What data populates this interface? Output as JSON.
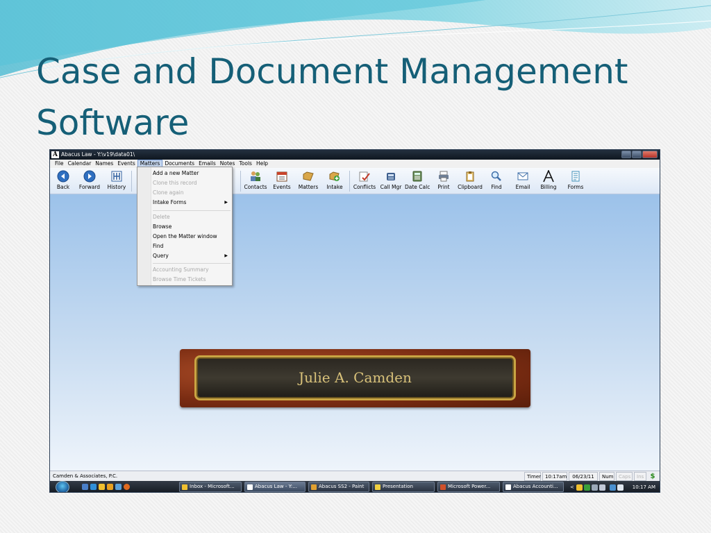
{
  "slide": {
    "title_line1": "Case and Document Management",
    "title_line2": "Software"
  },
  "window": {
    "app_logo": "A",
    "title": "Abacus Law  -  Y:\\v19\\data01\\"
  },
  "menubar": {
    "items": [
      "File",
      "Calendar",
      "Names",
      "Events",
      "Matters",
      "Documents",
      "Emails",
      "Notes",
      "Tools",
      "Help"
    ],
    "active": "Matters"
  },
  "toolbar": {
    "back": "Back",
    "forward": "Forward",
    "history": "History",
    "contacts": "Contacts",
    "events": "Events",
    "matters": "Matters",
    "intake": "Intake",
    "conflicts": "Conflicts",
    "call_mgr": "Call Mgr",
    "date_calc": "Date Calc",
    "print": "Print",
    "clipboard": "Clipboard",
    "find": "Find",
    "email": "Email",
    "billing": "Billing",
    "forms": "Forms"
  },
  "dropdown": {
    "add_new_matter": "Add a new Matter",
    "clone_record": "Clone this record",
    "clone_again": "Clone again",
    "intake_forms": "Intake Forms",
    "delete": "Delete",
    "browse": "Browse",
    "open_matter_window": "Open the Matter window",
    "find": "Find",
    "query": "Query",
    "accounting_summary": "Accounting Summary",
    "browse_time_tickets": "Browse Time Tickets",
    "submenu_arrow": "▶"
  },
  "nameplate": {
    "name": "Julie A. Camden"
  },
  "statusbar": {
    "firm": "Camden & Associates, P.C.",
    "timer": "Timer",
    "time": "10:17am",
    "date": "06/23/11",
    "num": "Num",
    "caps": "Caps",
    "ins": "Ins",
    "money_icon": "$"
  },
  "taskbar": {
    "tasks": [
      "Inbox - Microsoft...",
      "Abacus Law  -  Y:...",
      "Abacus SS2 - Paint",
      "Presentation",
      "Microsoft Power...",
      "Abacus Accounti..."
    ],
    "tray_arrow": "<",
    "clock": "10:17 AM"
  },
  "colors": {
    "title": "#155f77",
    "desktop": "#9cc2ea",
    "plate_text": "#d9c27a"
  }
}
